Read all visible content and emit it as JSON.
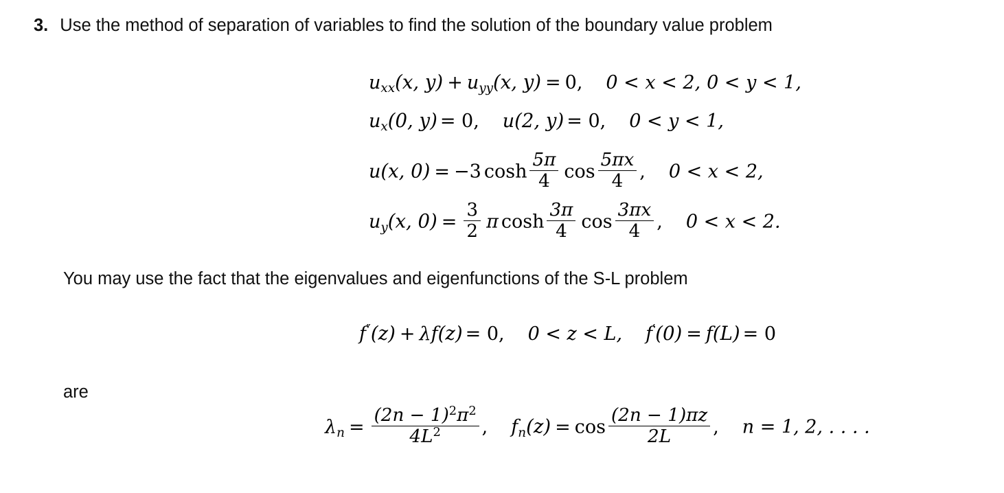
{
  "document": {
    "background_color": "#ffffff",
    "text_color": "#000000",
    "problem": {
      "number": "3.",
      "statement": "Use the method of separation of variables to find the solution of the boundary value problem"
    },
    "hint_text": "You may use the fact that the eigenvalues and eigenfunctions of the S-L problem",
    "are_text": "are"
  },
  "equations": {
    "pde": {
      "lhs_u_xx": "u",
      "sub_xx": "xx",
      "arg1": "(x, y)",
      "plus": "+",
      "lhs_u_yy": "u",
      "sub_yy": "yy",
      "arg2": "(x, y)",
      "equals": "=",
      "rhs": "0,",
      "domain_x": "0 < x < 2,",
      "domain_y": "0 < y < 1,"
    },
    "bc_x": {
      "u": "u",
      "sub_x": "x",
      "arg1": "(0, y)",
      "eq1": "= 0,",
      "u2": "u",
      "arg2": "(2, y)",
      "eq2": "= 0,",
      "domain": "0 < y < 1,"
    },
    "ic_u": {
      "u": "u",
      "arg": "(x, 0)",
      "equals": "=",
      "coef": "−3",
      "cosh": "cosh",
      "frac1_num": "5π",
      "frac1_den": "4",
      "cos": "cos",
      "frac2_num": "5πx",
      "frac2_den": "4",
      "comma": ",",
      "domain": "0 < x < 2,"
    },
    "ic_uy": {
      "u": "u",
      "sub_y": "y",
      "arg": "(x, 0)",
      "equals": "=",
      "frac_coef_num": "3",
      "frac_coef_den": "2",
      "pi": "π",
      "cosh": "cosh",
      "frac1_num": "3π",
      "frac1_den": "4",
      "cos": "cos",
      "frac2_num": "3πx",
      "frac2_den": "4",
      "comma": ",",
      "domain": "0 < x < 2."
    },
    "sl_problem": {
      "f": "f",
      "primes": "″",
      "arg1": "(z)",
      "plus": "+",
      "lambda": "λ",
      "f2": "f",
      "arg2": "(z)",
      "equals": "= 0,",
      "domain": "0 < z < L,",
      "bc_f_prime": "f",
      "prime": "′",
      "bc_arg1": "(0)",
      "bc_eq1": "=",
      "bc_f": "f",
      "bc_arg2": "(L)",
      "bc_eq2": "= 0"
    },
    "eigen": {
      "lambda": "λ",
      "sub_n": "n",
      "equals": "=",
      "lambda_num_paren": "(2n − 1)",
      "lambda_num_sup": "2",
      "lambda_num_pi": "π",
      "lambda_num_pi_sup": "2",
      "lambda_den": "4L",
      "lambda_den_sup": "2",
      "comma1": ",",
      "f": "f",
      "f_sub_n": "n",
      "f_arg": "(z)",
      "f_equals": "=",
      "cos": "cos",
      "f_num": "(2n − 1)πz",
      "f_den": "2L",
      "comma2": ",",
      "index_range": "n = 1, 2, . . . ."
    }
  }
}
